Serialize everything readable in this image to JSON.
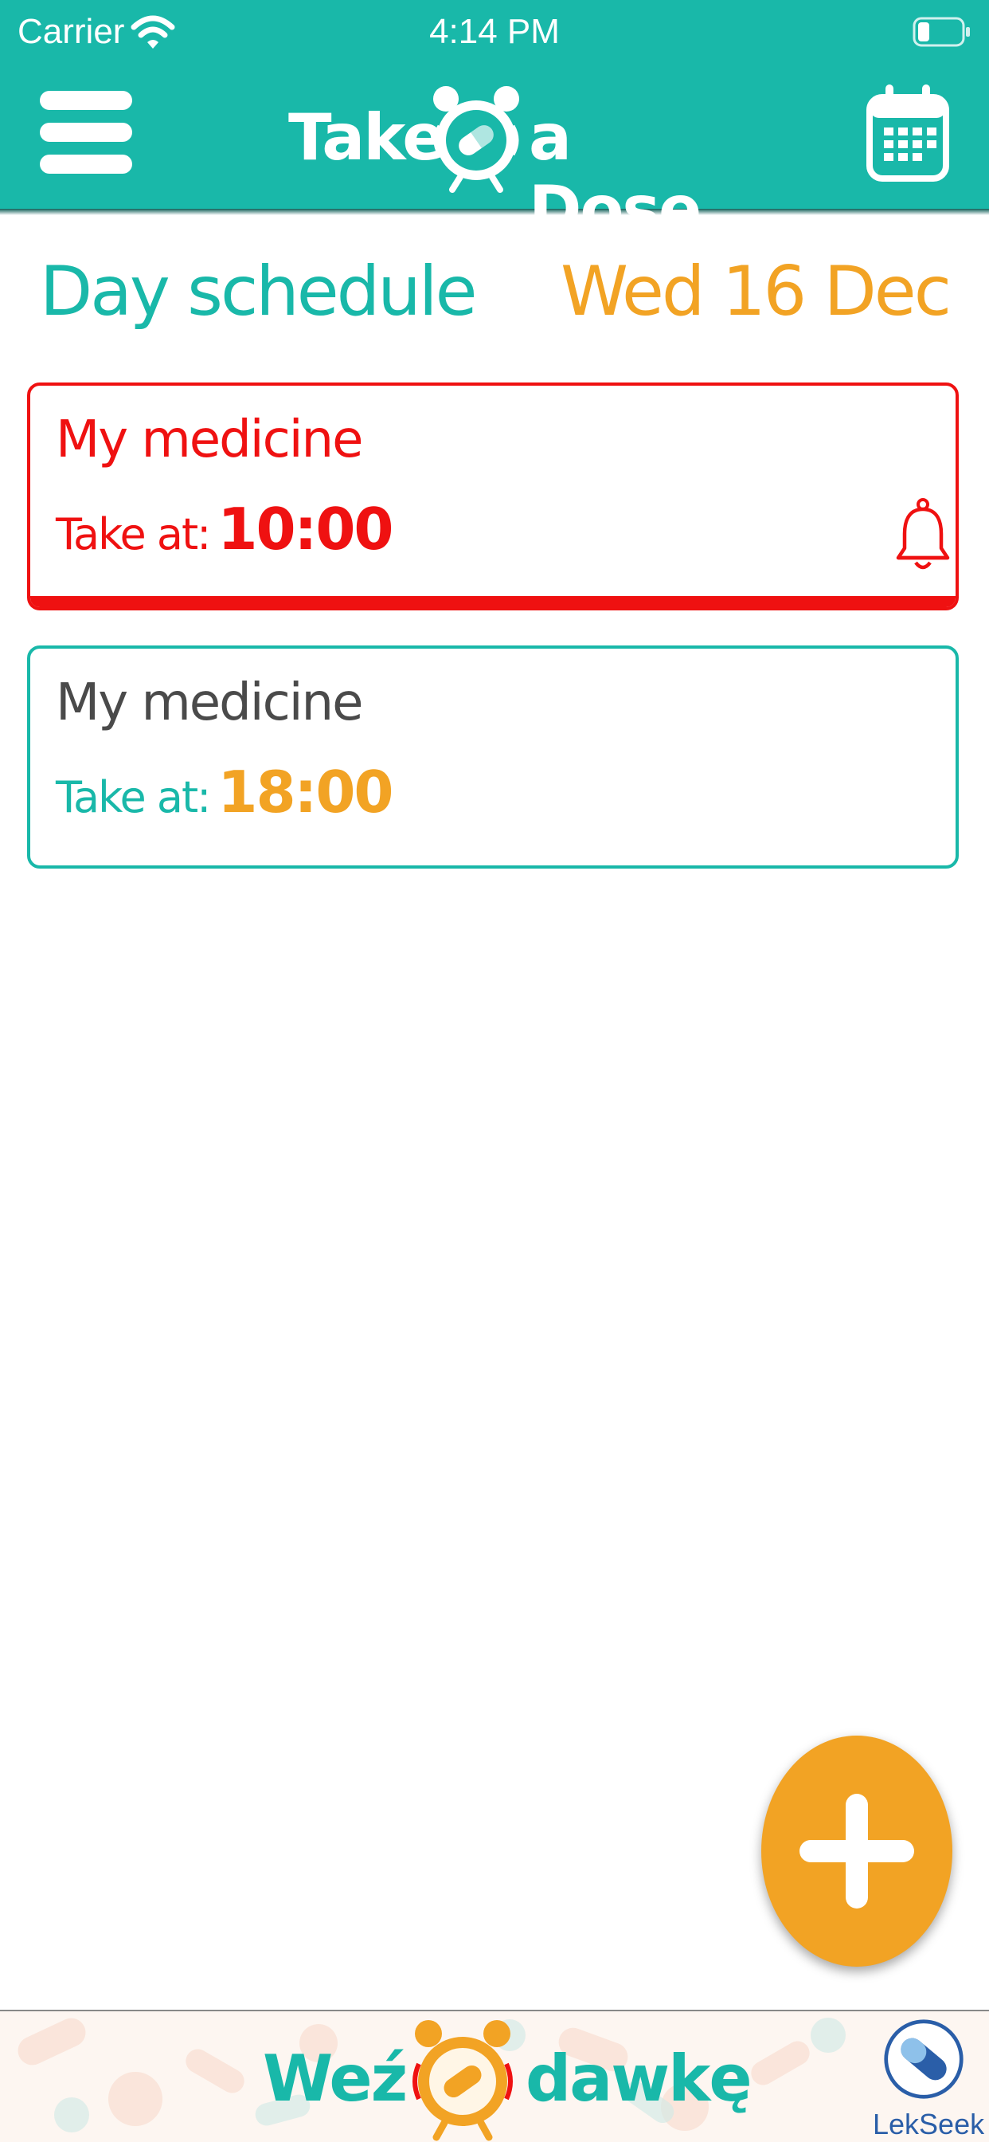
{
  "status_bar": {
    "carrier": "Carrier",
    "time": "4:14 PM"
  },
  "header": {
    "logo_left": "Take",
    "logo_right": "a Dose"
  },
  "schedule": {
    "title": "Day schedule",
    "date": "Wed 16 Dec"
  },
  "doses": [
    {
      "name": "My medicine",
      "take_label": "Take at:",
      "time": "10:00",
      "status": "overdue"
    },
    {
      "name": "My medicine",
      "take_label": "Take at:",
      "time": "18:00",
      "status": "upcoming"
    }
  ],
  "banner": {
    "left_text": "Weź",
    "right_text": "dawkę",
    "partner": "LekSeek"
  },
  "colors": {
    "teal": "#19b8a9",
    "orange": "#f2a324",
    "red": "#ef1111",
    "gray_text": "#4a4a4a"
  },
  "icons": {
    "menu": "hamburger-menu-icon",
    "calendar": "calendar-icon",
    "bell": "bell-icon",
    "add": "plus-icon",
    "logo_clock": "alarm-clock-pill-icon"
  }
}
